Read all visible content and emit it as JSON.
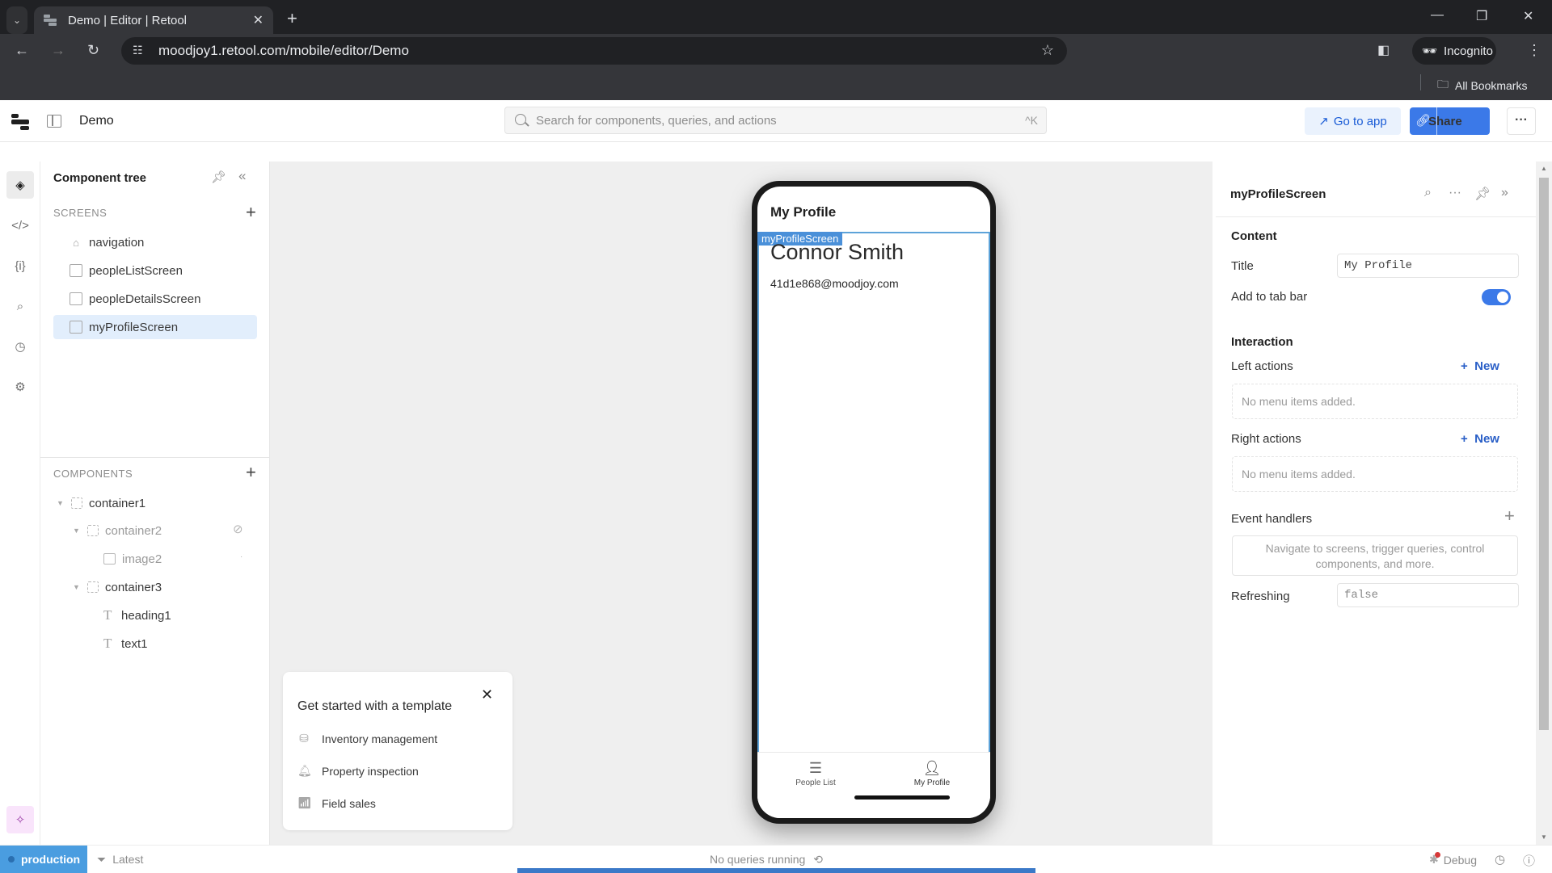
{
  "browser": {
    "tab_title": "Demo | Editor | Retool",
    "url": "moodjoy1.retool.com/mobile/editor/Demo",
    "profile_label": "Incognito",
    "bookmarks_label": "All Bookmarks"
  },
  "header": {
    "app_name": "Demo",
    "search_placeholder": "Search for components, queries, and actions",
    "search_shortcut": "^K",
    "goto_app_label": "Go to app",
    "share_label": "Share"
  },
  "left_panel": {
    "title": "Component tree",
    "screens_heading": "SCREENS",
    "screens": [
      {
        "label": "navigation",
        "icon": "home-icon"
      },
      {
        "label": "peopleListScreen",
        "icon": "screen-home-icon"
      },
      {
        "label": "peopleDetailsScreen",
        "icon": "screen-icon"
      },
      {
        "label": "myProfileScreen",
        "icon": "screen-home-icon",
        "selected": true
      }
    ],
    "components_heading": "COMPONENTS",
    "components": [
      {
        "label": "container1",
        "icon": "container-icon",
        "depth": 0,
        "expanded": true
      },
      {
        "label": "container2",
        "icon": "container-icon",
        "depth": 1,
        "expanded": true,
        "hidden": true
      },
      {
        "label": "image2",
        "icon": "image-icon",
        "depth": 2,
        "hidden": true
      },
      {
        "label": "container3",
        "icon": "container-icon",
        "depth": 1,
        "expanded": true
      },
      {
        "label": "heading1",
        "icon": "text-icon",
        "depth": 2
      },
      {
        "label": "text1",
        "icon": "text-icon",
        "depth": 2
      }
    ]
  },
  "template_card": {
    "title": "Get started with a template",
    "items": [
      {
        "label": "Inventory management",
        "icon": "database-icon"
      },
      {
        "label": "Property inspection",
        "icon": "bell-icon"
      },
      {
        "label": "Field sales",
        "icon": "chart-icon"
      }
    ]
  },
  "phone": {
    "screen_title": "My Profile",
    "selection_label": "myProfileScreen",
    "name": "Connor Smith",
    "email": "41d1e868@moodjoy.com",
    "tabs": [
      {
        "label": "People List",
        "icon": "list-icon",
        "active": false
      },
      {
        "label": "My Profile",
        "icon": "person-icon",
        "active": true
      }
    ]
  },
  "inspector": {
    "title": "myProfileScreen",
    "content_heading": "Content",
    "title_label": "Title",
    "title_value": "My Profile",
    "tab_bar_label": "Add to tab bar",
    "tab_bar_enabled": true,
    "interaction_heading": "Interaction",
    "left_actions_label": "Left actions",
    "right_actions_label": "Right actions",
    "new_label": "New",
    "empty_menu_text": "No menu items added.",
    "event_handlers_label": "Event handlers",
    "event_handlers_hint": "Navigate to screens, trigger queries, control components, and more.",
    "refreshing_label": "Refreshing",
    "refreshing_placeholder": "false"
  },
  "status_bar": {
    "environment": "production",
    "version": "Latest",
    "queries_status": "No queries running",
    "debug_label": "Debug"
  }
}
